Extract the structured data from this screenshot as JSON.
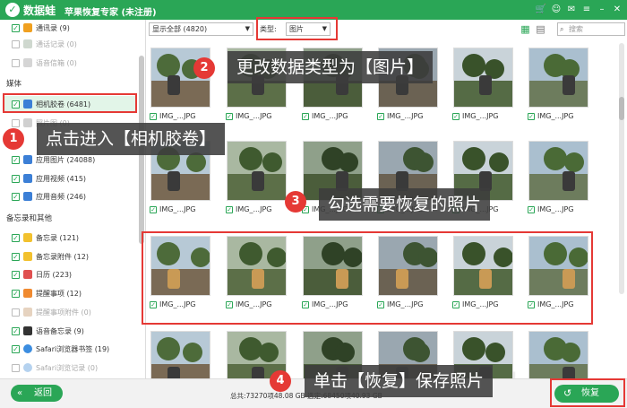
{
  "app": {
    "brand": "数据蛙",
    "title": "苹果恢复专家 (未注册)",
    "window_icons": [
      "cart-icon",
      "user-icon",
      "chat-icon",
      "menu-icon",
      "minimize-icon",
      "close-icon"
    ]
  },
  "sidebar": {
    "groups": {
      "media": "媒体",
      "memo": "备忘录和其他"
    },
    "items": [
      {
        "label": "通讯录 (9)",
        "checked": true
      },
      {
        "label": "通话记录 (0)",
        "checked": false,
        "dim": true
      },
      {
        "label": "语音信箱 (0)",
        "checked": false,
        "dim": true
      },
      {
        "label": "相机胶卷 (6481)",
        "checked": true
      },
      {
        "label": "照片图 (0)",
        "checked": false,
        "dim": true
      },
      {
        "label": "应用图片 (24088)",
        "checked": true
      },
      {
        "label": "应用视频 (415)",
        "checked": true
      },
      {
        "label": "应用音频 (246)",
        "checked": true
      },
      {
        "label": "备忘录 (121)",
        "checked": true
      },
      {
        "label": "备忘录附件 (12)",
        "checked": true
      },
      {
        "label": "日历 (223)",
        "checked": true
      },
      {
        "label": "提醒事项 (12)",
        "checked": true
      },
      {
        "label": "提醒事项附件 (0)",
        "checked": false,
        "dim": true
      },
      {
        "label": "语音备忘录 (9)",
        "checked": true
      },
      {
        "label": "Safari浏览器书签 (19)",
        "checked": true
      },
      {
        "label": "Safari浏览记录 (0)",
        "checked": false,
        "dim": true
      }
    ]
  },
  "toolbar": {
    "filter_value": "显示全部 (4820)",
    "type_label": "类型:",
    "type_value": "图片",
    "search_placeholder": "搜索"
  },
  "gallery": {
    "filenames": [
      "IMG_...JPG",
      "IMG_...JPG",
      "IMG_...JPG",
      "IMG_...JPG",
      "IMG_...JPG",
      "IMG_...JPG",
      "IMG_...JPG",
      "IMG_...JPG",
      "IMG_...JPG",
      "IMG_...JPG",
      "IMG_...JPG",
      "IMG_...JPG",
      "IMG_...JPG",
      "IMG_...JPG",
      "IMG_...JPG",
      "IMG_...JPG",
      "IMG_...JPG",
      "IMG_...JPG"
    ]
  },
  "bottom": {
    "back_label": "返回",
    "total_text": "总共:73270项48.08 GB 选定:68450项40.93 GB",
    "restore_label": "恢复"
  },
  "annotations": {
    "step1": {
      "num": "1",
      "text": "点击进入【相机胶卷】"
    },
    "step2": {
      "num": "2",
      "text": "更改数据类型为【图片】"
    },
    "step3": {
      "num": "3",
      "text": "勾选需要恢复的照片"
    },
    "step4": {
      "num": "4",
      "text": "单击【恢复】保存照片"
    }
  },
  "colors": {
    "brand_green": "#2aa656",
    "annotation_red": "#e53935"
  }
}
